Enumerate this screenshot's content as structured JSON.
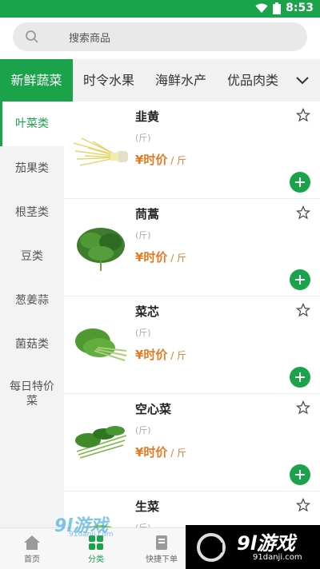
{
  "status": {
    "time": "8:53"
  },
  "search": {
    "placeholder": "搜索商品"
  },
  "tabs": [
    {
      "label": "新鲜蔬菜",
      "active": true
    },
    {
      "label": "时令水果",
      "active": false
    },
    {
      "label": "海鲜水产",
      "active": false
    },
    {
      "label": "优品肉类",
      "active": false
    }
  ],
  "side": [
    {
      "label": "叶菜类",
      "active": true
    },
    {
      "label": "茄果类",
      "active": false
    },
    {
      "label": "根茎类",
      "active": false
    },
    {
      "label": "豆类",
      "active": false
    },
    {
      "label": "葱姜蒜",
      "active": false
    },
    {
      "label": "菌菇类",
      "active": false
    },
    {
      "label": "每日特价菜",
      "active": false
    }
  ],
  "products": [
    {
      "name": "韭黄",
      "unit": "(斤)",
      "price": "¥时价",
      "per": " / 斤"
    },
    {
      "name": "茼蒿",
      "unit": "(斤)",
      "price": "¥时价",
      "per": " / 斤"
    },
    {
      "name": "菜芯",
      "unit": "(斤)",
      "price": "¥时价",
      "per": " / 斤"
    },
    {
      "name": "空心菜",
      "unit": "(斤)",
      "price": "¥时价",
      "per": " / 斤"
    },
    {
      "name": "生菜",
      "unit": "(斤)",
      "price": "",
      "per": ""
    }
  ],
  "bottom_nav": [
    {
      "label": "首页",
      "icon": "home-icon",
      "active": false
    },
    {
      "label": "分类",
      "icon": "category-icon",
      "active": true
    },
    {
      "label": "快捷下单",
      "icon": "quick-order-icon",
      "active": false
    }
  ],
  "watermark": {
    "left_big": "9l游戏",
    "left_small": "91danji.com",
    "right_big": "9l游戏",
    "right_small": "91danji.com"
  },
  "colors": {
    "primary": "#1aa34a",
    "price": "#e67a22"
  }
}
